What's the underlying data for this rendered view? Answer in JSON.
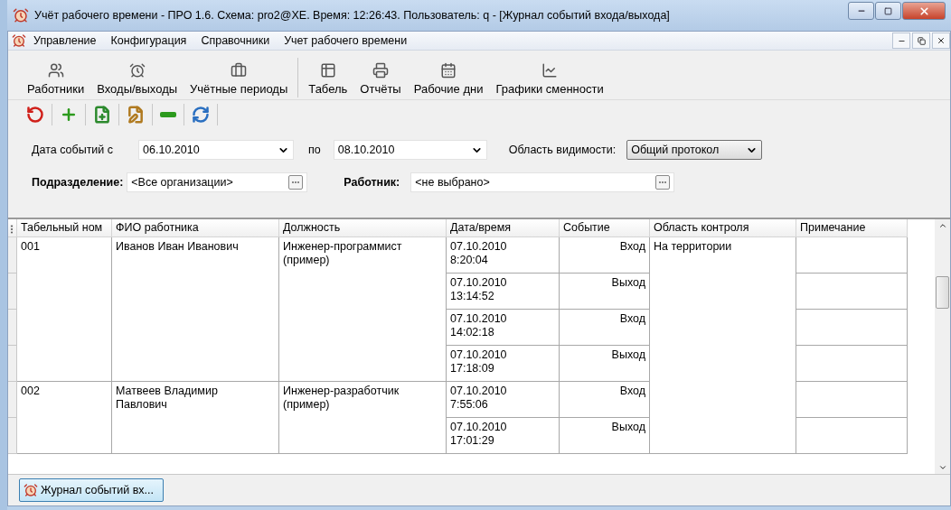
{
  "window": {
    "title": "Учёт рабочего времени - ПРО 1.6. Схема: pro2@XE. Время: 12:26:43. Пользователь: q - [Журнал событий входа/выхода]"
  },
  "menu": [
    "Управление",
    "Конфигурация",
    "Справочники",
    "Учет рабочего времени"
  ],
  "toolbar": [
    {
      "label": "Работники",
      "kind": "users"
    },
    {
      "label": "Входы/выходы",
      "kind": "clock"
    },
    {
      "label": "Учётные периоды",
      "kind": "case"
    },
    {
      "label": "Табель",
      "kind": "sheet",
      "separator_before": true
    },
    {
      "label": "Отчёты",
      "kind": "printer"
    },
    {
      "label": "Рабочие дни",
      "kind": "calendar"
    },
    {
      "label": "Графики сменности",
      "kind": "chart"
    }
  ],
  "actions": [
    {
      "kind": "reset"
    },
    {
      "kind": "add"
    },
    {
      "kind": "new-doc"
    },
    {
      "kind": "edit"
    },
    {
      "kind": "remove"
    },
    {
      "kind": "refresh"
    }
  ],
  "filters": {
    "date_from_label": "Дата событий с",
    "date_from": "06.10.2010",
    "date_to_label": "по",
    "date_to": "08.10.2010",
    "scope_label": "Область видимости:",
    "scope": "Общий протокол",
    "department_label": "Подразделение:",
    "department": "<Все организации>",
    "employee_label": "Работник:",
    "employee": "<не выбрано>"
  },
  "table": {
    "columns": [
      "Табельный ном",
      "ФИО работника",
      "Должность",
      "Дата/время",
      "Событие",
      "Область контроля",
      "Примечание"
    ],
    "control_area": "На территории",
    "employees": [
      {
        "number": "001",
        "name": "Иванов Иван Иванович",
        "position": "Инженер-программист (пример)",
        "events": [
          {
            "date": "07.10.2010",
            "time": "8:20:04",
            "event": "Вход"
          },
          {
            "date": "07.10.2010",
            "time": "13:14:52",
            "event": "Выход"
          },
          {
            "date": "07.10.2010",
            "time": "14:02:18",
            "event": "Вход"
          },
          {
            "date": "07.10.2010",
            "time": "17:18:09",
            "event": "Выход"
          }
        ]
      },
      {
        "number": "002",
        "name": "Матвеев Владимир Павлович",
        "position": "Инженер-разработчик (пример)",
        "events": [
          {
            "date": "07.10.2010",
            "time": "7:55:06",
            "event": "Вход"
          },
          {
            "date": "07.10.2010",
            "time": "17:01:29",
            "event": "Выход"
          }
        ]
      }
    ]
  },
  "taskbar": [
    {
      "label": "Журнал событий вх...",
      "selected": true
    }
  ]
}
